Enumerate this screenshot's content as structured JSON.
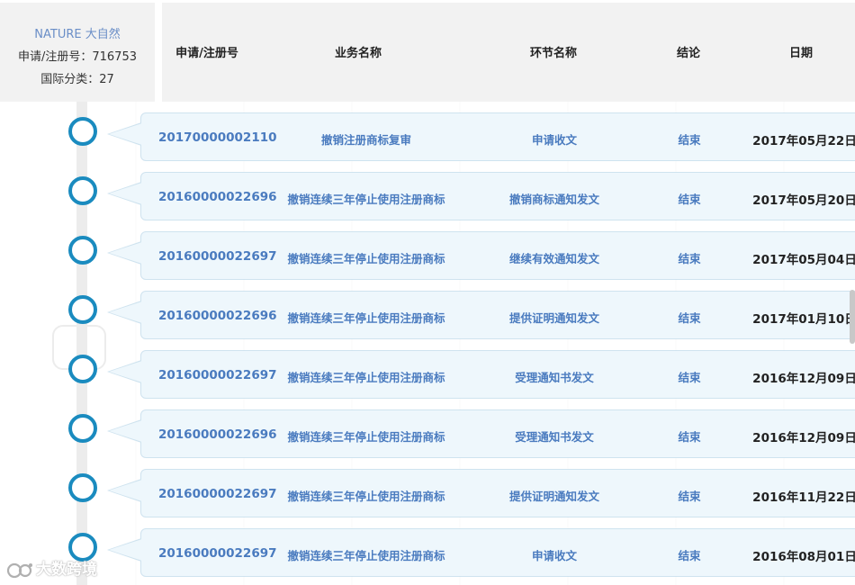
{
  "brand": {
    "name": "NATURE 大自然",
    "registration": "申请/注册号：716753",
    "classification": "国际分类：27"
  },
  "columns": {
    "reg_no": "申请/注册号",
    "business": "业务名称",
    "step": "环节名称",
    "result": "结论",
    "date": "日期"
  },
  "records": [
    {
      "reg_no": "20170000002110",
      "business": "撤销注册商标复审",
      "step": "申请收文",
      "result": "结束",
      "date": "2017年05月22日"
    },
    {
      "reg_no": "20160000022696",
      "business": "撤销连续三年停止使用注册商标",
      "step": "撤销商标通知发文",
      "result": "结束",
      "date": "2017年05月20日"
    },
    {
      "reg_no": "20160000022697",
      "business": "撤销连续三年停止使用注册商标",
      "step": "继续有效通知发文",
      "result": "结束",
      "date": "2017年05月04日"
    },
    {
      "reg_no": "20160000022696",
      "business": "撤销连续三年停止使用注册商标",
      "step": "提供证明通知发文",
      "result": "结束",
      "date": "2017年01月10日"
    },
    {
      "reg_no": "20160000022697",
      "business": "撤销连续三年停止使用注册商标",
      "step": "受理通知书发文",
      "result": "结束",
      "date": "2016年12月09日"
    },
    {
      "reg_no": "20160000022696",
      "business": "撤销连续三年停止使用注册商标",
      "step": "受理通知书发文",
      "result": "结束",
      "date": "2016年12月09日"
    },
    {
      "reg_no": "20160000022697",
      "business": "撤销连续三年停止使用注册商标",
      "step": "提供证明通知发文",
      "result": "结束",
      "date": "2016年11月22日"
    },
    {
      "reg_no": "20160000022697",
      "business": "撤销连续三年停止使用注册商标",
      "step": "申请收文",
      "result": "结束",
      "date": "2016年08月01日"
    }
  ],
  "watermark": {
    "text": "大数跨境",
    "icon": "logo-icon"
  },
  "colors": {
    "accent": "#1a8bbf",
    "link": "#4a7bbf",
    "card_bg": "#eef7fc",
    "header_bg": "#f2f2f2"
  }
}
